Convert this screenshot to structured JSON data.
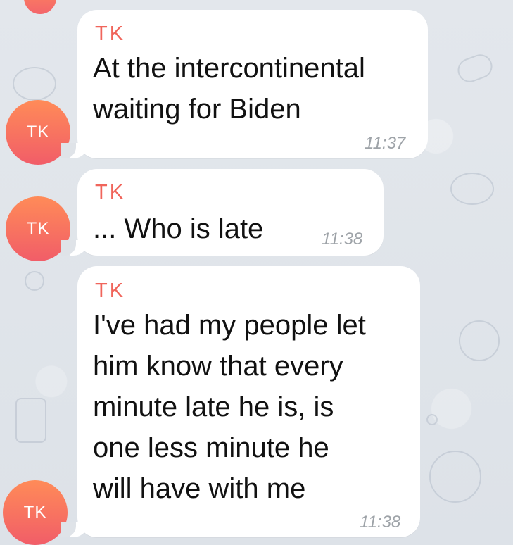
{
  "chat": {
    "messages": [
      {
        "avatar_initials": "TK",
        "sender": "TK",
        "text": "At the intercontinental\nwaiting for Biden",
        "time": "11:37"
      },
      {
        "avatar_initials": "TK",
        "sender": "TK",
        "text": "... Who is late",
        "time": "11:38"
      },
      {
        "avatar_initials": "TK",
        "sender": "TK",
        "text": "I've had my people let\nhim know that every\nminute late he is, is\none less minute he\nwill have with me",
        "time": "11:38"
      }
    ]
  },
  "theme": {
    "avatar_gradient_top": "#ff8b58",
    "avatar_gradient_bottom": "#f15d68",
    "sender_color": "#f0655b",
    "timestamp_color": "#9ea3a8",
    "bubble_color": "#ffffff",
    "chat_background": "#dfe3e8"
  }
}
